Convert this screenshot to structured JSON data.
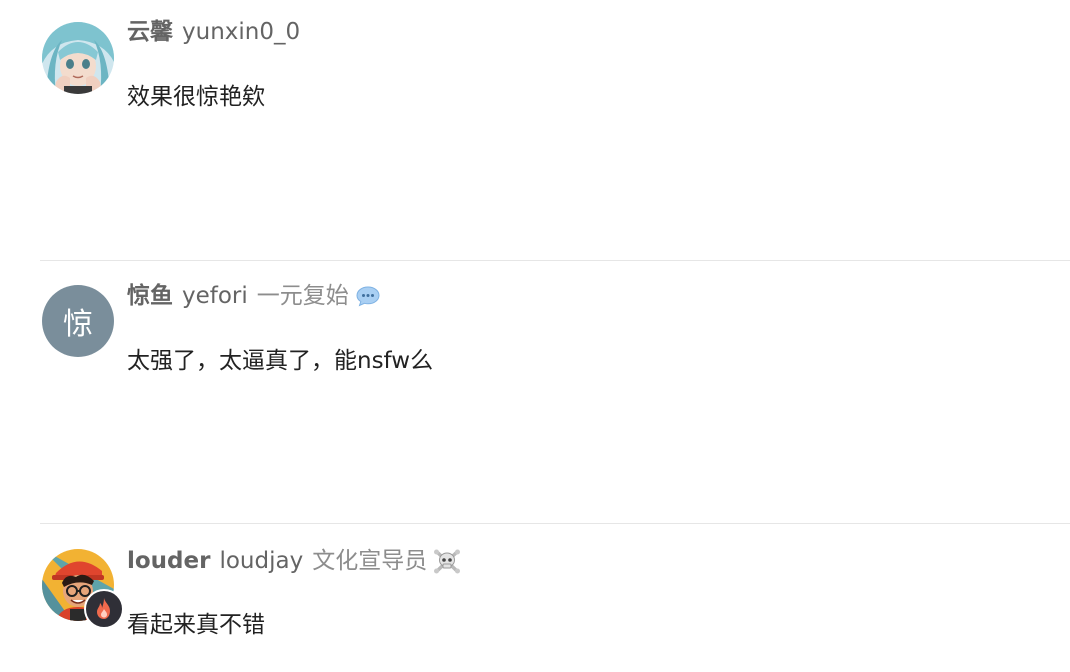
{
  "posts": [
    {
      "full_name": "云馨",
      "username": "yunxin0_0",
      "user_title": "",
      "avatar": "anime-girl-avatar",
      "text": "效果很惊艳欸"
    },
    {
      "full_name": "惊鱼",
      "username": "yefori",
      "user_title": "一元复始",
      "title_icon": "speech-bubble-icon",
      "avatar_letter": "惊",
      "avatar_color": "#7a8e9b",
      "text": "太强了，太逼真了，能nsfw么"
    },
    {
      "full_name": "louder",
      "username": "loudjay",
      "user_title": "文化宣导员",
      "title_icon": "skull-crossbones-icon",
      "avatar": "cartoon-guy-avatar",
      "flair_icon": "fire-icon",
      "text": "看起来真不错"
    }
  ],
  "colors": {
    "divider": "#e6e6e6",
    "name": "#646464",
    "title": "#8d8d8d",
    "text": "#222222",
    "letter_avatar": "#7a8e9b"
  }
}
